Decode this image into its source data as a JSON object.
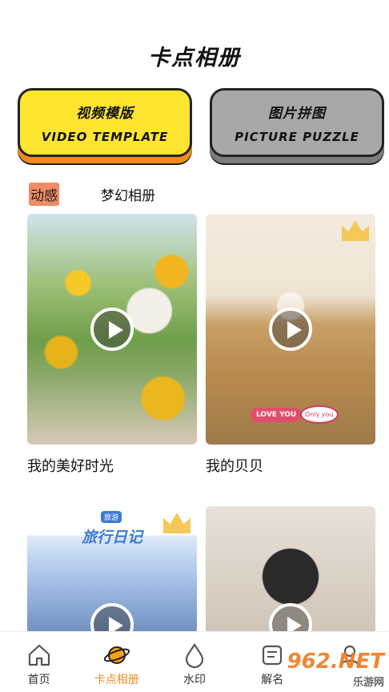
{
  "header": {
    "title": "卡点相册"
  },
  "modes": [
    {
      "cn": "视频模版",
      "en": "VIDEO TEMPLATE"
    },
    {
      "cn": "图片拼图",
      "en": "PICTURE PUZZLE"
    }
  ],
  "tabs": [
    {
      "label": "动感",
      "active": true
    },
    {
      "label": "梦幻相册",
      "active": false
    }
  ],
  "cards": [
    {
      "title": "我的美好时光"
    },
    {
      "title": "我的贝贝",
      "stickers": [
        "LOVE YOU",
        "Only you"
      ]
    },
    {
      "title": "",
      "overlay_title": "旅行日记",
      "badge": "旅游"
    },
    {
      "title": ""
    }
  ],
  "bottom_nav": [
    {
      "label": "首页",
      "icon": "home-icon"
    },
    {
      "label": "卡点相册",
      "icon": "planet-icon",
      "active": true
    },
    {
      "label": "水印",
      "icon": "drop-icon"
    },
    {
      "label": "解名",
      "icon": "card-icon"
    },
    {
      "label": "",
      "icon": "user-icon"
    }
  ],
  "watermark": {
    "main": "962.NET",
    "sub": "乐游网"
  },
  "colors": {
    "accent": "#f18c1a",
    "video_btn": "#fde530",
    "puzzle_btn": "#a8a8a8",
    "tab_active": "#ef8c66"
  }
}
